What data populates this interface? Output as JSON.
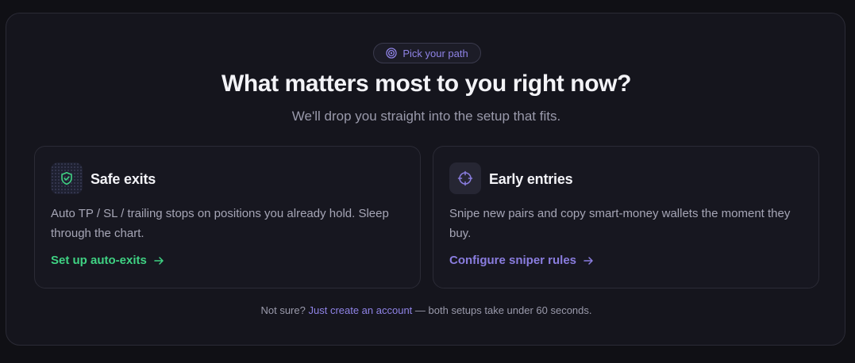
{
  "badge": {
    "label": "Pick your path",
    "icon": "target-icon"
  },
  "headline": "What matters most to you right now?",
  "subhead": "We'll drop you straight into the setup that fits.",
  "cards": [
    {
      "icon": "shield-check-icon",
      "title": "Safe exits",
      "description": "Auto TP / SL / trailing stops on positions you already hold. Sleep through the chart.",
      "link": "Set up auto-exits",
      "accent": "#3fd283"
    },
    {
      "icon": "crosshair-icon",
      "title": "Early entries",
      "description": "Snipe new pairs and copy smart-money wallets the moment they buy.",
      "link": "Configure sniper rules",
      "accent": "#8a7ddf"
    }
  ],
  "footer": {
    "prefix": "Not sure?",
    "link": "Just create an account",
    "suffix": "— both setups take under 60 seconds."
  },
  "colors": {
    "background": "#101015",
    "panel": "#15151d",
    "accent_purple": "#8f83e6",
    "accent_green": "#3fd283"
  }
}
